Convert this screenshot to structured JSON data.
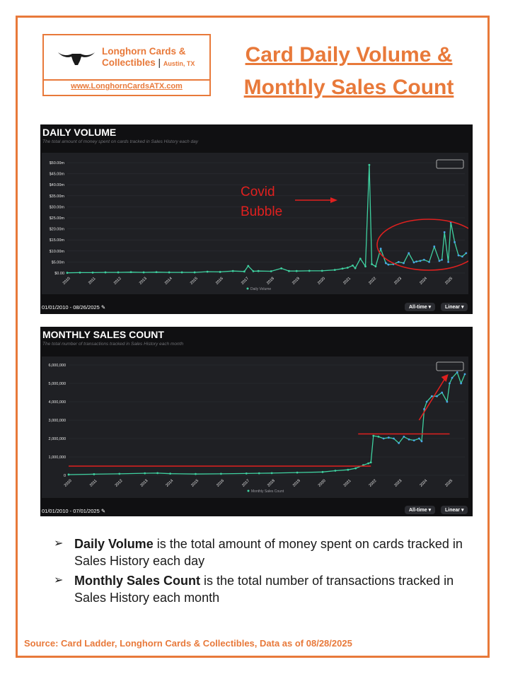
{
  "logo": {
    "name_line1": "Longhorn Cards &",
    "name_line2": "Collectibles",
    "city": "Austin, TX",
    "url": "www.LonghornCardsATX.com"
  },
  "title": {
    "line1": "Card Daily Volume &",
    "line2": "Monthly Sales Count"
  },
  "annotation": {
    "line1": "Covid",
    "line2": "Bubble"
  },
  "ui": {
    "all_time": "All-time",
    "linear": "Linear"
  },
  "bullets": [
    {
      "bold": "Daily Volume",
      "rest": " is the total amount of money spent on cards tracked in Sales History each day"
    },
    {
      "bold": "Monthly Sales Count",
      "rest": " is the total number of transactions tracked in Sales History each month"
    }
  ],
  "source": "Source:  Card Ladder, Longhorn Cards & Collectibles, Data as of 08/28/2025",
  "colors": {
    "accent": "#e8793a",
    "series": "#3fd1a0",
    "marker": "#4aa5e8",
    "annotation": "#e0201f"
  },
  "chart_data": [
    {
      "type": "line",
      "title": "DAILY VOLUME",
      "subtitle": "The total amount of money spent on cards tracked in Sales History each day",
      "date_range": "01/01/2010 - 08/26/2025",
      "xlabel": "",
      "ylabel": "",
      "x_ticks": [
        "2010",
        "2011",
        "2012",
        "2013",
        "2014",
        "2015",
        "2016",
        "2017",
        "2018",
        "2019",
        "2020",
        "2021",
        "2022",
        "2023",
        "2024",
        "2025"
      ],
      "y_ticks": [
        "$0.00",
        "$5.00m",
        "$10.00m",
        "$15.00m",
        "$20.00m",
        "$25.00m",
        "$30.00m",
        "$35.00m",
        "$40.00m",
        "$45.00m",
        "$50.00m"
      ],
      "ylim": [
        0,
        50
      ],
      "legend": "bottom-center",
      "series": [
        {
          "name": "Daily Volume",
          "x": [
            2010,
            2010.5,
            2011,
            2011.5,
            2012,
            2012.5,
            2013,
            2013.5,
            2014,
            2014.5,
            2015,
            2015.5,
            2016,
            2016.5,
            2016.95,
            2017.1,
            2017.3,
            2017.5,
            2018,
            2018.4,
            2018.7,
            2019,
            2019.5,
            2020,
            2020.5,
            2020.8,
            2021,
            2021.2,
            2021.3,
            2021.5,
            2021.7,
            2021.85,
            2021.95,
            2022.1,
            2022.3,
            2022.5,
            2022.6,
            2022.8,
            2023,
            2023.2,
            2023.4,
            2023.6,
            2023.7,
            2023.85,
            2024,
            2024.2,
            2024.4,
            2024.6,
            2024.7,
            2024.8,
            2024.95,
            2025.05,
            2025.2,
            2025.35,
            2025.5,
            2025.65
          ],
          "values": [
            0.1,
            0.2,
            0.2,
            0.3,
            0.3,
            0.4,
            0.3,
            0.4,
            0.3,
            0.3,
            0.3,
            0.6,
            0.5,
            0.9,
            0.7,
            3.2,
            0.8,
            0.9,
            0.8,
            2.1,
            0.9,
            0.9,
            1.0,
            1.0,
            1.4,
            2.0,
            2.4,
            3.4,
            2.2,
            6.5,
            3.0,
            49.0,
            4.0,
            3.0,
            11.0,
            4.5,
            3.8,
            4.0,
            5.0,
            4.5,
            9.0,
            4.8,
            5.2,
            5.5,
            6.0,
            5.0,
            12.0,
            5.5,
            6.0,
            18.5,
            5.0,
            23.0,
            14.0,
            8.0,
            7.5,
            9.0
          ]
        }
      ]
    },
    {
      "type": "line",
      "title": "MONTHLY SALES COUNT",
      "subtitle": "The total number of transactions tracked in Sales History each month",
      "date_range": "01/01/2010 - 07/01/2025",
      "xlabel": "",
      "ylabel": "",
      "x_ticks": [
        "2010",
        "2011",
        "2012",
        "2013",
        "2014",
        "2015",
        "2016",
        "2017",
        "2018",
        "2019",
        "2020",
        "2021",
        "2022",
        "2023",
        "2024",
        "2025"
      ],
      "y_ticks": [
        "0",
        "1,000,000",
        "2,000,000",
        "3,000,000",
        "4,000,000",
        "5,000,000",
        "6,000,000"
      ],
      "ylim": [
        0,
        6000000
      ],
      "legend": "bottom-center",
      "series": [
        {
          "name": "Monthly Sales Count",
          "x": [
            2010,
            2011,
            2012,
            2013,
            2013.5,
            2014,
            2015,
            2016,
            2017,
            2017.5,
            2018,
            2019,
            2020,
            2020.5,
            2021,
            2021.3,
            2021.6,
            2021.8,
            2021.9,
            2022.0,
            2022.2,
            2022.4,
            2022.6,
            2022.8,
            2023,
            2023.2,
            2023.4,
            2023.6,
            2023.8,
            2023.9,
            2024.0,
            2024.1,
            2024.3,
            2024.5,
            2024.7,
            2024.9,
            2025.0,
            2025.1,
            2025.3,
            2025.45,
            2025.6
          ],
          "values": [
            40000,
            60000,
            80000,
            110000,
            120000,
            90000,
            70000,
            80000,
            100000,
            110000,
            120000,
            150000,
            180000,
            250000,
            300000,
            380000,
            550000,
            650000,
            700000,
            2150000,
            2100000,
            2000000,
            2050000,
            2000000,
            1750000,
            2100000,
            1950000,
            1900000,
            2000000,
            1850000,
            3600000,
            4000000,
            4300000,
            4300000,
            4500000,
            4000000,
            5000000,
            5300000,
            5600000,
            5000000,
            5500000
          ]
        }
      ],
      "annotations": [
        "horizontal line ~500,000 (2010–2021.9)",
        "horizontal line ~2,250,000 (2021.4–2025)",
        "upward arrow 2023.8→2025"
      ]
    }
  ]
}
